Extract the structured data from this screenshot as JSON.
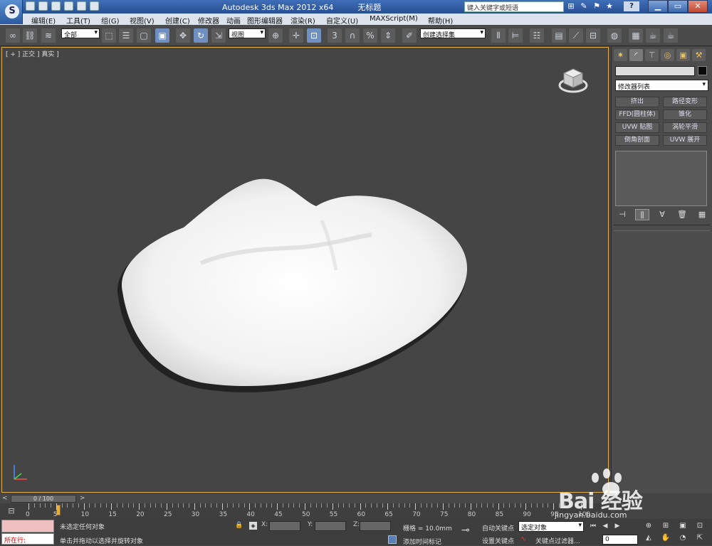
{
  "title": {
    "app": "Autodesk 3ds Max  2012 x64",
    "file": "无标题"
  },
  "search": {
    "placeholder": "键入关键字或短语"
  },
  "menu": [
    "编辑(E)",
    "工具(T)",
    "组(G)",
    "视图(V)",
    "创建(C)",
    "修改器",
    "动画",
    "图形编辑器",
    "渲染(R)",
    "自定义(U)",
    "MAXScript(M)",
    "帮助(H)"
  ],
  "toolbar": {
    "filter": "全部",
    "refcoord": "视图",
    "selset": "创建选择集",
    "snap_label": "3"
  },
  "viewport": {
    "label": "[ + ] 正交 ] 真实 ]"
  },
  "panel": {
    "modlist": "修改器列表",
    "buttons": [
      "挤出",
      "路径变形",
      "FFD(圆柱体)",
      "锥化",
      "UVW 贴图",
      "涡轮平滑",
      "倒角剖面",
      "UVW 展开"
    ]
  },
  "timeslider": {
    "value": "0 / 100",
    "prev": "<",
    "next": ">"
  },
  "ruler": {
    "labels": [
      "0",
      "5",
      "10",
      "15",
      "20",
      "25",
      "30",
      "35",
      "40",
      "45",
      "50",
      "55",
      "60",
      "65",
      "70",
      "75",
      "80",
      "85",
      "90",
      "95",
      "100"
    ]
  },
  "status": {
    "maxscript": "所在行:",
    "line1": "未选定任何对象",
    "line2": "单击并拖动以选择并旋转对象",
    "x": "X:",
    "y": "Y:",
    "z": "Z:",
    "grid": "栅格 = 10.0mm",
    "addtime": "添加时间标记",
    "autokey": "自动关键点",
    "setkey": "设置关键点",
    "seldd": "选定对象",
    "keyfilter": "关键点过滤器...",
    "frame": "0"
  },
  "watermark": {
    "brand": "Bai  经验",
    "url": "jingyan.baidu.com"
  }
}
